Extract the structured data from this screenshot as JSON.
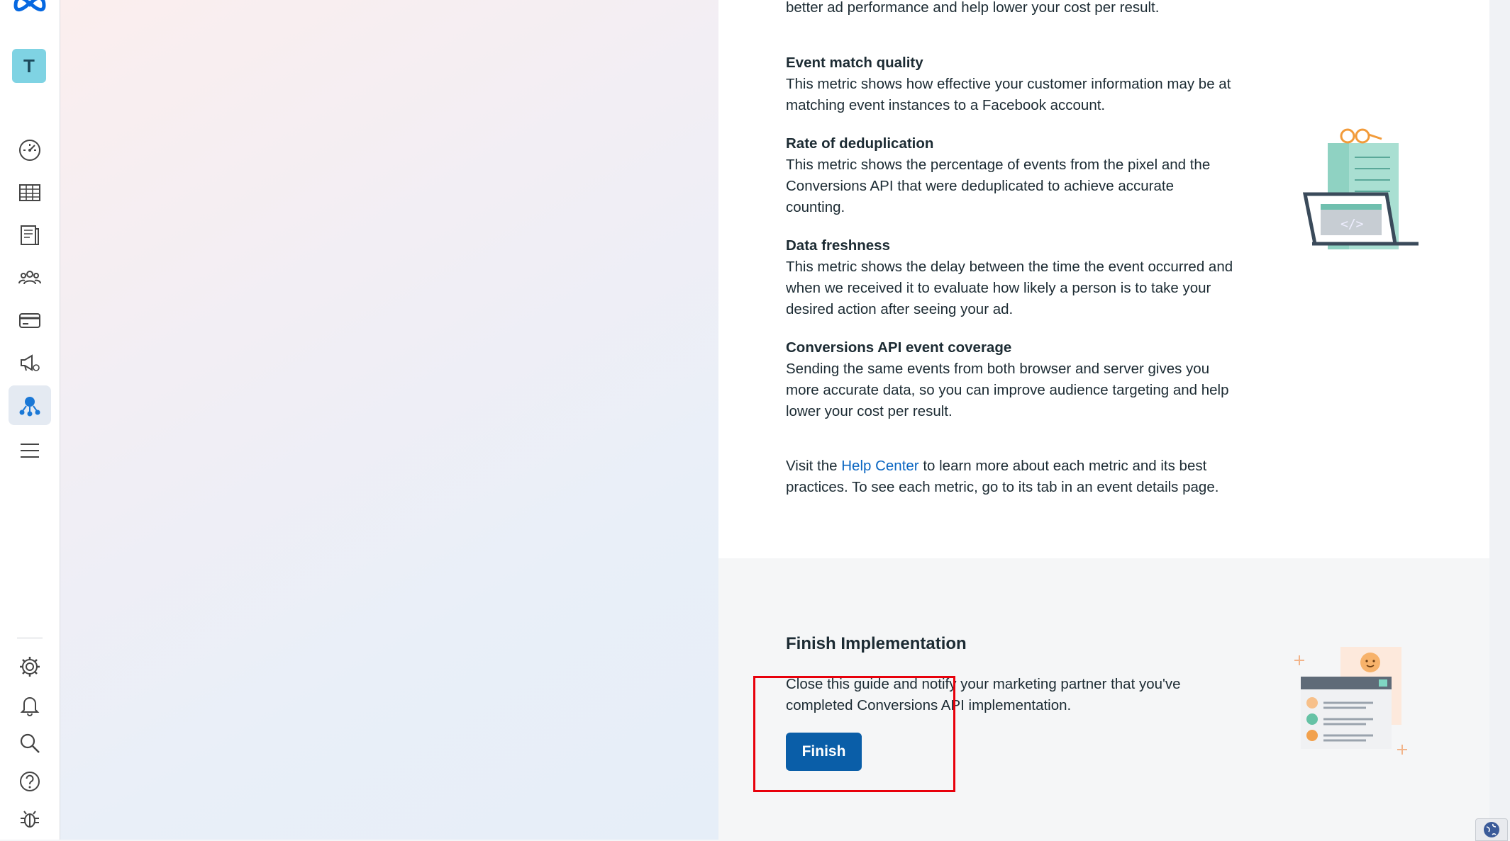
{
  "nav": {
    "avatar_letter": "T",
    "icons": [
      "meta-logo-icon",
      "dashboard-icon",
      "table-icon",
      "pages-icon",
      "audiences-icon",
      "billing-card-icon",
      "campaign-megaphone-icon",
      "events-manager-icon",
      "menu-icon",
      "settings-icon",
      "notifications-icon",
      "search-icon",
      "help-icon",
      "bug-report-icon"
    ]
  },
  "content": {
    "intro_tail": "better ad performance and help lower your cost per result.",
    "metrics": [
      {
        "title": "Event match quality",
        "lines": [
          "This metric shows how effective your customer information may be at",
          "matching event instances to a Facebook account."
        ]
      },
      {
        "title": "Rate of deduplication",
        "lines": [
          "This metric shows the percentage of events from the pixel and the",
          "Conversions API that were deduplicated to achieve accurate",
          "counting."
        ]
      },
      {
        "title": "Data freshness",
        "lines": [
          "This metric shows the delay between the time the event occurred and",
          "when we received it to evaluate how likely a person is to take your",
          "desired action after seeing your ad."
        ]
      },
      {
        "title": "Conversions API event coverage",
        "lines": [
          "Sending the same events from both browser and server gives you",
          "more accurate data, so you can improve audience targeting and help",
          "lower your cost per result."
        ]
      }
    ],
    "help": {
      "prefix": "Visit the ",
      "link": "Help Center",
      "suffix": " to learn more about each metric and its best",
      "line2": "practices. To see each metric, go to its tab in an event details page."
    }
  },
  "finish": {
    "title": "Finish Implementation",
    "line1": "Close this guide and notify your marketing partner that you've",
    "line2": "completed Conversions API implementation.",
    "button": "Finish"
  },
  "colors": {
    "accent": "#0a5ea8",
    "highlight": "#e8000b",
    "link": "#0a66c2"
  }
}
